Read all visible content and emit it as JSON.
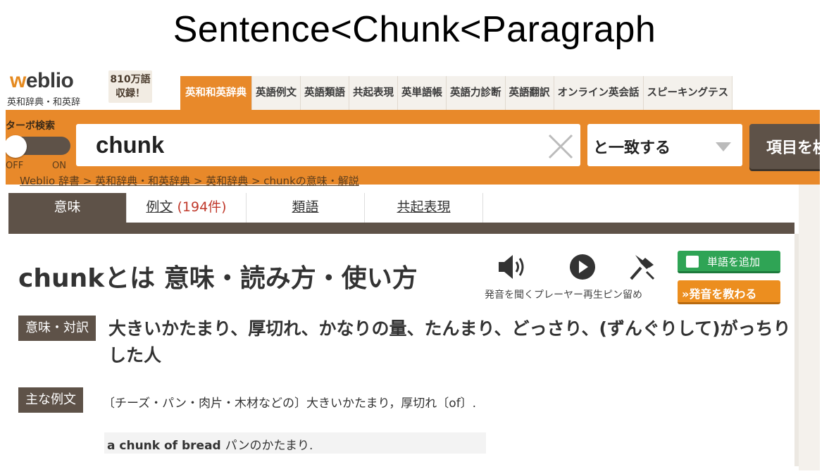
{
  "slide": {
    "title": "Sentence<Chunk<Paragraph"
  },
  "header": {
    "logo": "weblio",
    "logo_sub": "英和辞典・和英辞",
    "badge_line1": "810万語",
    "badge_line2": "収録！",
    "nav_tabs": [
      {
        "label": "英和和英辞典",
        "active": true
      },
      {
        "label": "英語例文",
        "active": false
      },
      {
        "label": "英語類語",
        "active": false
      },
      {
        "label": "共起表現",
        "active": false
      },
      {
        "label": "英単語帳",
        "active": false
      },
      {
        "label": "英語力診断",
        "active": false
      },
      {
        "label": "英語翻訳",
        "active": false
      },
      {
        "label": "オンライン英会話",
        "active": false
      },
      {
        "label": "スピーキングテス",
        "active": false
      }
    ]
  },
  "search": {
    "turbo_label": "ターボ検索",
    "toggle_off": "OFF",
    "toggle_on": "ON",
    "query": "chunk",
    "match_mode": "と一致する",
    "submit_label": "項目を検",
    "breadcrumb": "Weblio 辞書 > 英和辞典・和英辞典 > 英和辞典 > chunkの意味・解説"
  },
  "tabs": [
    {
      "label": "意味",
      "count": "",
      "active": true
    },
    {
      "label": "例文",
      "count": "(194件)",
      "active": false
    },
    {
      "label": "類語",
      "count": "",
      "active": false
    },
    {
      "label": "共起表現",
      "count": "",
      "active": false
    }
  ],
  "entry": {
    "title": "chunkとは 意味・読み方・使い方",
    "icon_caption": "発音を聞くプレーヤー再生ピン留め",
    "add_word_label": "単語を追加",
    "teach_pron_label": "»発音を教わる",
    "meaning_label": "意味・対訳",
    "meaning": "大きいかたまり、厚切れ、かなりの量、たんまり、どっさり、(ずんぐりして)がっちりした人",
    "example_label": "主な例文",
    "example_def": "〔チーズ・パン・肉片・木材などの〕大きいかたまり，厚切れ〔of〕.",
    "example_en": "a chunk of bread",
    "example_ja": "パンのかたまり."
  },
  "colors": {
    "accent_orange": "#e8892a",
    "dark_brown": "#5e5248",
    "green": "#2fa455"
  }
}
